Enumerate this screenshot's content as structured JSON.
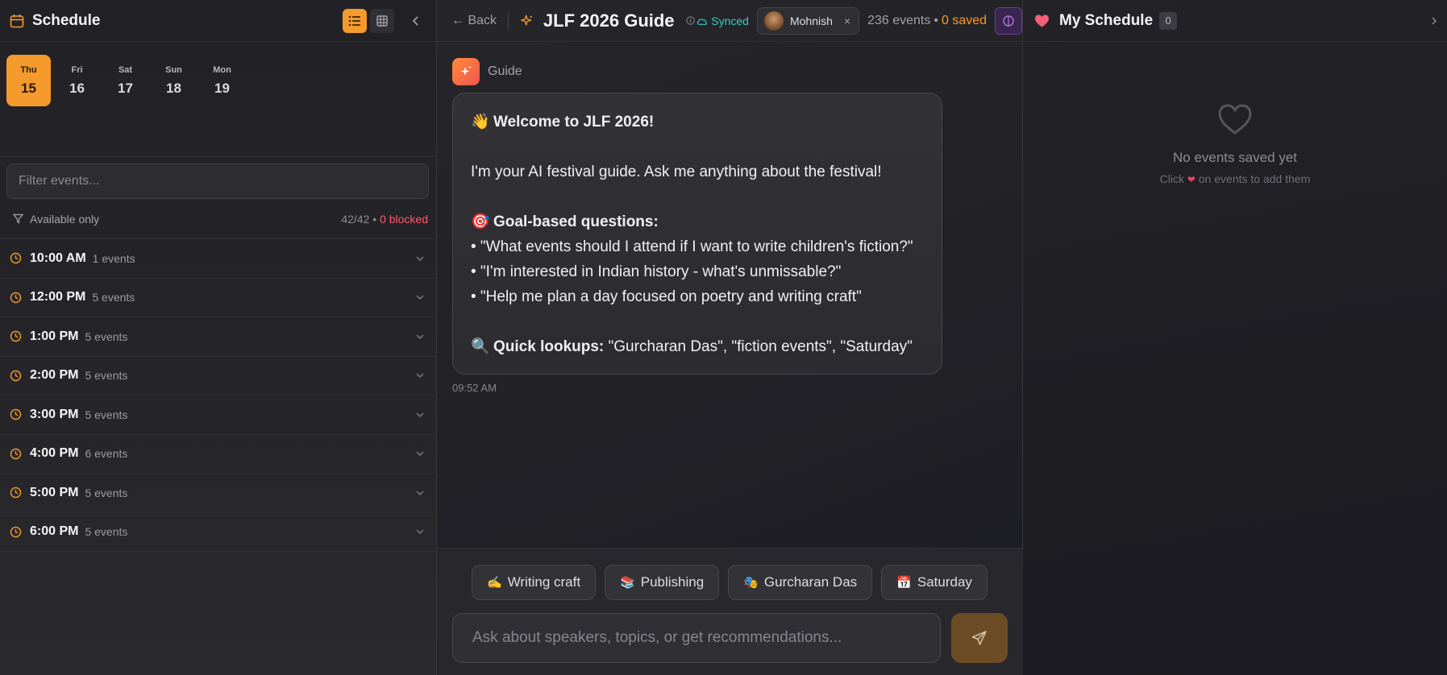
{
  "left": {
    "title": "Schedule",
    "days": [
      {
        "name": "Thu",
        "num": "15",
        "active": true
      },
      {
        "name": "Fri",
        "num": "16",
        "active": false
      },
      {
        "name": "Sat",
        "num": "17",
        "active": false
      },
      {
        "name": "Sun",
        "num": "18",
        "active": false
      },
      {
        "name": "Mon",
        "num": "19",
        "active": false
      }
    ],
    "filter_placeholder": "Filter events...",
    "available_label": "Available only",
    "counts": "42/42",
    "separator": "•",
    "blocked": "0 blocked",
    "slots": [
      {
        "time": "10:00 AM",
        "count": "1 events"
      },
      {
        "time": "12:00 PM",
        "count": "5 events"
      },
      {
        "time": "1:00 PM",
        "count": "5 events"
      },
      {
        "time": "2:00 PM",
        "count": "5 events"
      },
      {
        "time": "3:00 PM",
        "count": "5 events"
      },
      {
        "time": "4:00 PM",
        "count": "6 events"
      },
      {
        "time": "5:00 PM",
        "count": "5 events"
      },
      {
        "time": "6:00 PM",
        "count": "5 events"
      }
    ]
  },
  "center": {
    "back": "← Back",
    "title": "JLF 2026 Guide",
    "synced": "Synced",
    "user": "Mohnish",
    "close": "×",
    "events": "236 events",
    "dot": "•",
    "saved": "0 saved",
    "guide_name": "Guide",
    "message": {
      "welcome_emoji": "👋",
      "welcome": "Welcome to JLF 2026!",
      "intro": "I'm your AI festival guide. Ask me anything about the festival!",
      "goal_emoji": "🎯",
      "goal_heading": "Goal-based questions:",
      "q1": "• \"What events should I attend if I want to write children's fiction?\"",
      "q2": "• \"I'm interested in Indian history - what's unmissable?\"",
      "q3": "• \"Help me plan a day focused on poetry and writing craft\"",
      "lookup_emoji": "🔍",
      "lookup_heading": "Quick lookups:",
      "lookup_text": " \"Gurcharan Das\", \"fiction events\", \"Saturday\""
    },
    "timestamp": "09:52 AM",
    "chips": [
      {
        "emoji": "✍️",
        "label": "Writing craft"
      },
      {
        "emoji": "📚",
        "label": "Publishing"
      },
      {
        "emoji": "🎭",
        "label": "Gurcharan Das"
      },
      {
        "emoji": "📅",
        "label": "Saturday"
      }
    ],
    "ask_placeholder": "Ask about speakers, topics, or get recommendations..."
  },
  "right": {
    "title": "My Schedule",
    "count": "0",
    "empty_title": "No events saved yet",
    "empty_sub_before": "Click",
    "empty_sub_heart": "❤",
    "empty_sub_after": "on events to add them"
  },
  "colors": {
    "accent": "#f59a2c",
    "blocked": "#ff5a6e",
    "synced": "#2fd0c4",
    "heart": "#f2607a"
  }
}
